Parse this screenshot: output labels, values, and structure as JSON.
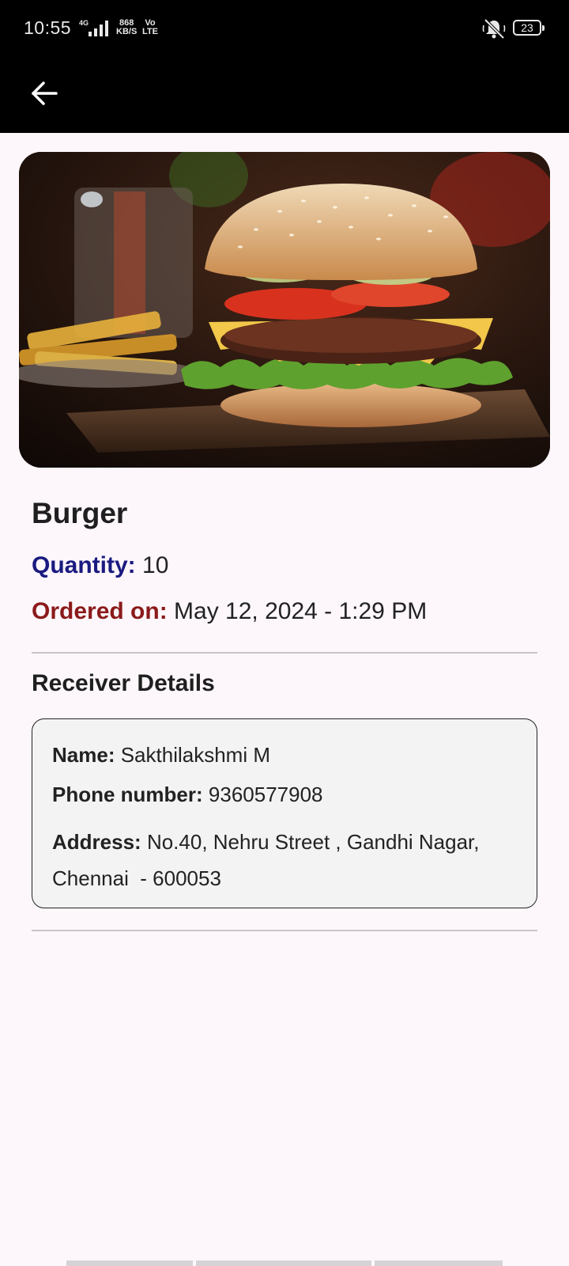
{
  "status_bar": {
    "time": "10:55",
    "network_type": "4G",
    "speed_value": "868",
    "speed_unit": "KB/S",
    "volte_top": "Vo",
    "volte_bottom": "LTE",
    "battery_level": "23",
    "mute_icon": "bell-off-icon"
  },
  "app_bar": {
    "back_icon": "arrow-left-icon"
  },
  "item": {
    "name": "Burger",
    "quantity_label": "Quantity:",
    "quantity_value": "10",
    "ordered_label": "Ordered on:",
    "ordered_value": "May 12, 2024 - 1:29 PM"
  },
  "receiver": {
    "section_title": "Receiver Details",
    "name_label": "Name:",
    "name_value": "Sakthilakshmi M",
    "phone_label": "Phone number:",
    "phone_value": "9360577908",
    "address_label": "Address:",
    "address_value": "No.40, Nehru Street , Gandhi Nagar, Chennai  - 600053"
  },
  "colors": {
    "quantity_label": "#1a1a80",
    "ordered_label": "#8b1a1a",
    "background": "#fdf7fb",
    "app_bar": "#000000",
    "card_background": "#f3f3f3"
  }
}
